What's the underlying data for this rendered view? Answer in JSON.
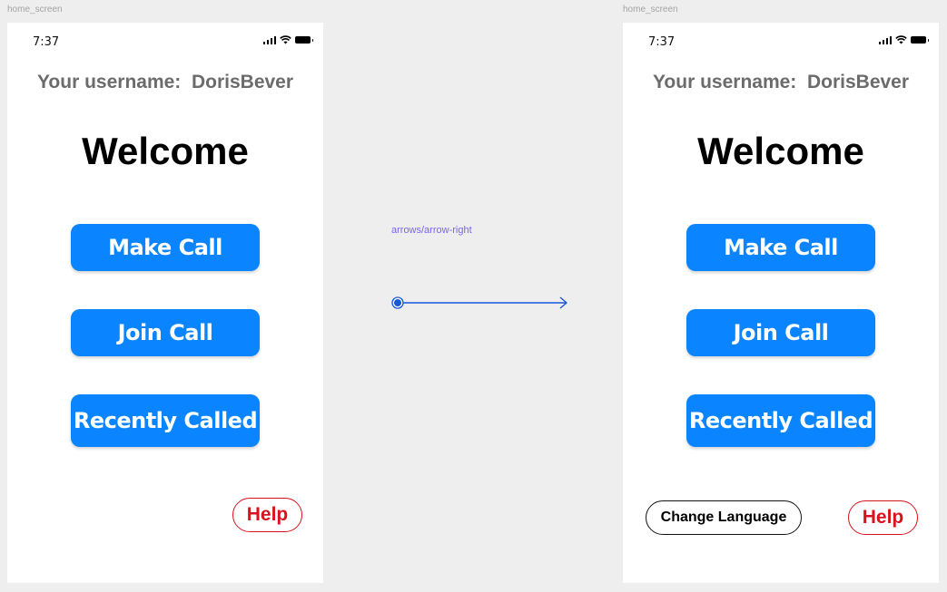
{
  "frames": [
    {
      "label": "home_screen",
      "status_time": "7:37",
      "username_label": "Your username:",
      "username_value": "DorisBever",
      "welcome": "Welcome",
      "buttons": {
        "make_call": "Make Call",
        "join_call": "Join Call",
        "recently_called": "Recently Called",
        "help": "Help"
      }
    },
    {
      "label": "home_screen",
      "status_time": "7:37",
      "username_label": "Your username:",
      "username_value": "DorisBever",
      "welcome": "Welcome",
      "buttons": {
        "make_call": "Make Call",
        "join_call": "Join Call",
        "recently_called": "Recently Called",
        "change_language": "Change Language",
        "help": "Help"
      }
    }
  ],
  "connector": {
    "label": "arrows/arrow-right",
    "icon": "arrow-right-icon",
    "color": "#1a56db"
  },
  "colors": {
    "primary": "#0a84ff",
    "help": "#d9121f",
    "canvas": "#eeeeee"
  }
}
